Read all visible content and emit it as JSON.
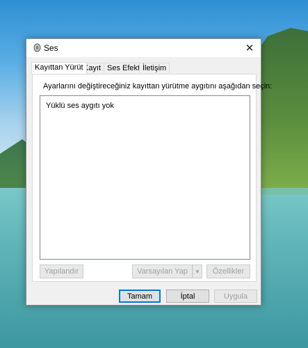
{
  "window": {
    "title": "Ses",
    "icon": "speaker-icon",
    "close_glyph": "✕"
  },
  "tabs": [
    {
      "label": "Kayıttan Yürüt",
      "active": true
    },
    {
      "label": "Kayıt",
      "active": false
    },
    {
      "label": "Ses Efekti",
      "active": false
    },
    {
      "label": "İletişim",
      "active": false
    }
  ],
  "panel": {
    "instruction": "Ayarlarını değiştireceğiniz kayıttan yürütme aygıtını aşağıdan seçin:",
    "empty_text": "Yüklü ses aygıtı yok",
    "configure_label": "Yapılandır",
    "set_default_label": "Varsayılan Yap",
    "properties_label": "Özellikler"
  },
  "footer": {
    "ok_label": "Tamam",
    "cancel_label": "İptal",
    "apply_label": "Uygula"
  }
}
